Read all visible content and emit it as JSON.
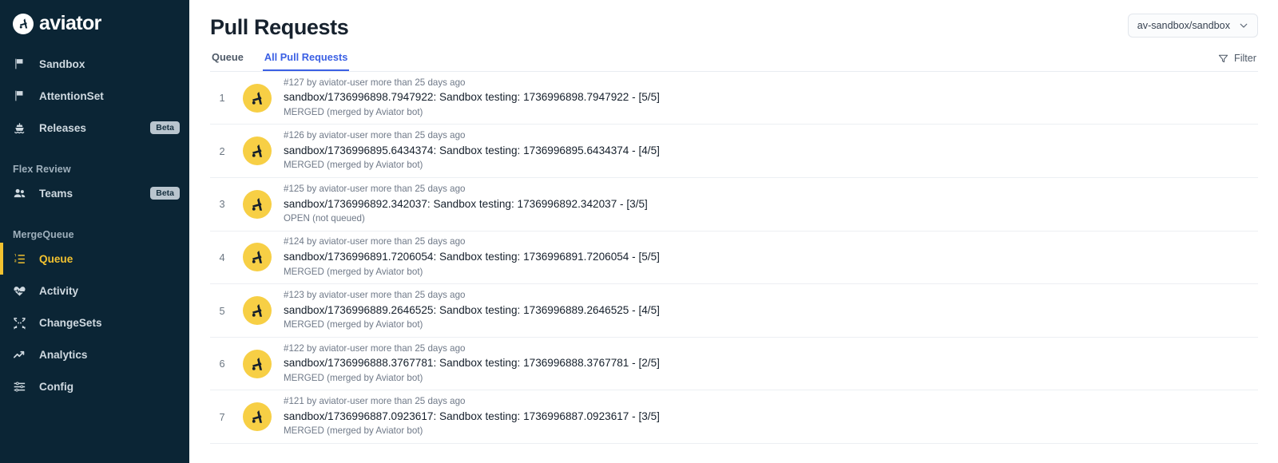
{
  "sidebar": {
    "brand": "aviator",
    "brand_icon": "aviator-logo-icon",
    "groups": [
      {
        "label": null,
        "items": [
          {
            "label": "Sandbox",
            "icon": "flag-icon",
            "badge": null,
            "active": false
          },
          {
            "label": "AttentionSet",
            "icon": "flag-icon",
            "badge": null,
            "active": false
          },
          {
            "label": "Releases",
            "icon": "ship-icon",
            "badge": "Beta",
            "active": false
          }
        ]
      },
      {
        "label": "Flex Review",
        "items": [
          {
            "label": "Teams",
            "icon": "users-icon",
            "badge": "Beta",
            "active": false
          }
        ]
      },
      {
        "label": "MergeQueue",
        "items": [
          {
            "label": "Queue",
            "icon": "ordered-list-icon",
            "badge": null,
            "active": true
          },
          {
            "label": "Activity",
            "icon": "heart-pulse-icon",
            "badge": null,
            "active": false
          },
          {
            "label": "ChangeSets",
            "icon": "merge-arrows-icon",
            "badge": null,
            "active": false
          },
          {
            "label": "Analytics",
            "icon": "trending-up-icon",
            "badge": null,
            "active": false
          },
          {
            "label": "Config",
            "icon": "sliders-icon",
            "badge": null,
            "active": false
          }
        ]
      }
    ]
  },
  "header": {
    "title": "Pull Requests",
    "repo_selector": {
      "value": "av-sandbox/sandbox",
      "chevron_icon": "chevron-down-icon"
    }
  },
  "tabs": [
    {
      "label": "Queue",
      "active": false
    },
    {
      "label": "All Pull Requests",
      "active": true
    }
  ],
  "filter": {
    "label": "Filter",
    "icon": "funnel-icon"
  },
  "pull_requests": [
    {
      "index": "1",
      "meta": "#127 by aviator-user more than 25 days ago",
      "title": "sandbox/1736996898.7947922: Sandbox testing: 1736996898.7947922 - [5/5]",
      "status": "MERGED (merged by Aviator bot)",
      "avatar_icon": "aviator-avatar-icon"
    },
    {
      "index": "2",
      "meta": "#126 by aviator-user more than 25 days ago",
      "title": "sandbox/1736996895.6434374: Sandbox testing: 1736996895.6434374 - [4/5]",
      "status": "MERGED (merged by Aviator bot)",
      "avatar_icon": "aviator-avatar-icon"
    },
    {
      "index": "3",
      "meta": "#125 by aviator-user more than 25 days ago",
      "title": "sandbox/1736996892.342037: Sandbox testing: 1736996892.342037 - [3/5]",
      "status": "OPEN (not queued)",
      "avatar_icon": "aviator-avatar-icon"
    },
    {
      "index": "4",
      "meta": "#124 by aviator-user more than 25 days ago",
      "title": "sandbox/1736996891.7206054: Sandbox testing: 1736996891.7206054 - [5/5]",
      "status": "MERGED (merged by Aviator bot)",
      "avatar_icon": "aviator-avatar-icon"
    },
    {
      "index": "5",
      "meta": "#123 by aviator-user more than 25 days ago",
      "title": "sandbox/1736996889.2646525: Sandbox testing: 1736996889.2646525 - [4/5]",
      "status": "MERGED (merged by Aviator bot)",
      "avatar_icon": "aviator-avatar-icon"
    },
    {
      "index": "6",
      "meta": "#122 by aviator-user more than 25 days ago",
      "title": "sandbox/1736996888.3767781: Sandbox testing: 1736996888.3767781 - [2/5]",
      "status": "MERGED (merged by Aviator bot)",
      "avatar_icon": "aviator-avatar-icon"
    },
    {
      "index": "7",
      "meta": "#121 by aviator-user more than 25 days ago",
      "title": "sandbox/1736996887.0923617: Sandbox testing: 1736996887.0923617 - [3/5]",
      "status": "MERGED (merged by Aviator bot)",
      "avatar_icon": "aviator-avatar-icon"
    }
  ],
  "colors": {
    "sidebar_bg": "#0b2535",
    "accent_yellow": "#f2c230",
    "avatar_yellow": "#f7cf45",
    "tab_active_blue": "#3b60e4",
    "text_dark": "#16202c",
    "text_muted": "#6f7988"
  }
}
